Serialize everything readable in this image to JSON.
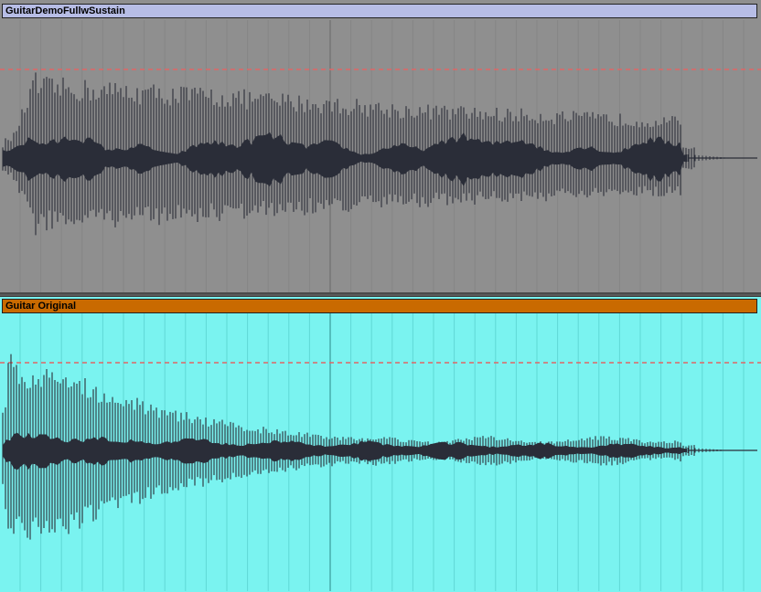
{
  "clips": [
    {
      "name": "GuitarDemoFullwSustain",
      "header_color": "#b7bde6",
      "background_color": "#8f8f8f",
      "waveform_color": "#2a2d38",
      "threshold_line_color": "#e06666",
      "envelope": "sustained"
    },
    {
      "name": "Guitar Original",
      "header_color": "#c96a00",
      "background_color": "#7af3f0",
      "waveform_color": "#2a2d38",
      "threshold_line_color": "#e06666",
      "envelope": "decaying"
    }
  ]
}
